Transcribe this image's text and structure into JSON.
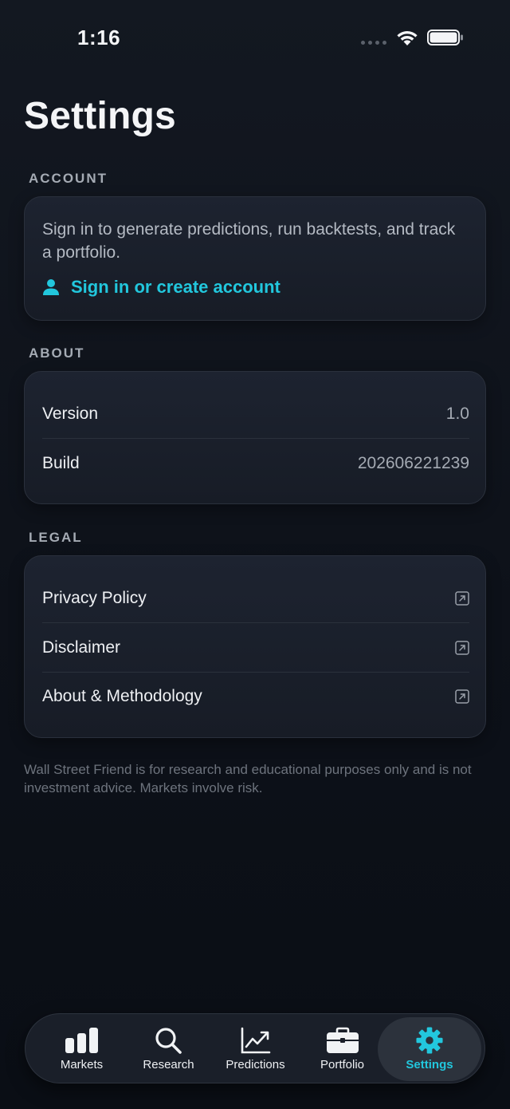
{
  "status_bar": {
    "time": "1:16"
  },
  "title": "Settings",
  "account": {
    "header": "ACCOUNT",
    "description": "Sign in to generate predictions, run backtests, and track a portfolio.",
    "signin_label": "Sign in or create account"
  },
  "about": {
    "header": "ABOUT",
    "rows": [
      {
        "label": "Version",
        "value": "1.0"
      },
      {
        "label": "Build",
        "value": "202606221239"
      }
    ]
  },
  "legal": {
    "header": "LEGAL",
    "items": [
      {
        "label": "Privacy Policy"
      },
      {
        "label": "Disclaimer"
      },
      {
        "label": "About & Methodology"
      }
    ]
  },
  "footer_note": "Wall Street Friend is for research and educational purposes only and is not investment advice. Markets involve risk.",
  "tabs": [
    {
      "label": "Markets",
      "icon": "bar-chart-icon"
    },
    {
      "label": "Research",
      "icon": "search-icon"
    },
    {
      "label": "Predictions",
      "icon": "trend-chart-icon"
    },
    {
      "label": "Portfolio",
      "icon": "briefcase-icon"
    },
    {
      "label": "Settings",
      "icon": "gear-icon",
      "active": true
    }
  ],
  "colors": {
    "accent": "#22c7dd",
    "background": "#0d1119",
    "card": "#1b212c"
  }
}
